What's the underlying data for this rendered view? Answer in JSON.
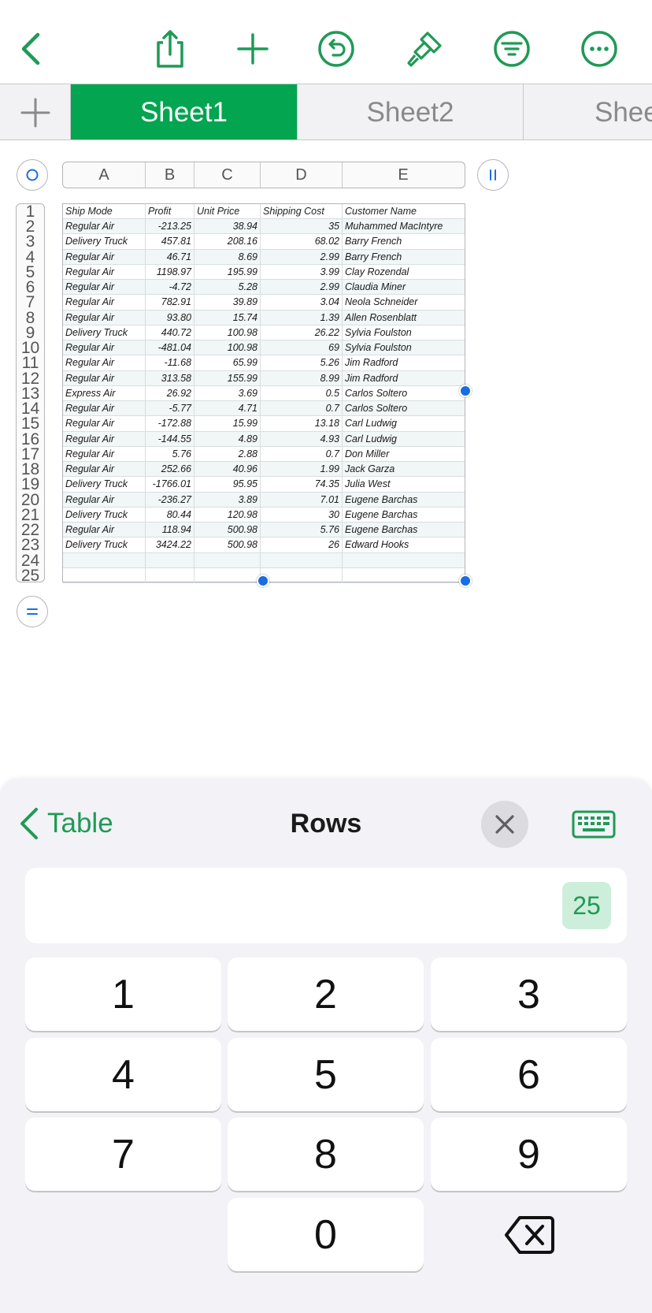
{
  "colors": {
    "accent": "#03a550",
    "icon_green": "#1f9a55",
    "handle_blue": "#1a6de0"
  },
  "toolbar": {
    "icons": [
      "back-chevron-icon",
      "share-icon",
      "add-icon",
      "undo-icon",
      "format-brush-icon",
      "organize-filter-icon",
      "more-icon"
    ]
  },
  "tabs": {
    "add_icon": "plus-icon",
    "items": [
      {
        "label": "Sheet1",
        "active": true
      },
      {
        "label": "Sheet2",
        "active": false
      },
      {
        "label": "Shee",
        "active": false
      }
    ]
  },
  "table": {
    "column_letters": [
      "A",
      "B",
      "C",
      "D",
      "E"
    ],
    "row_numbers": [
      "1",
      "2",
      "3",
      "4",
      "5",
      "6",
      "7",
      "8",
      "9",
      "10",
      "11",
      "12",
      "13",
      "14",
      "15",
      "16",
      "17",
      "18",
      "19",
      "20",
      "21",
      "22",
      "23",
      "24",
      "25"
    ],
    "headers": [
      "Ship Mode",
      "Profit",
      "Unit Price",
      "Shipping Cost",
      "Customer Name"
    ],
    "rows": [
      [
        "Regular Air",
        "-213.25",
        "38.94",
        "35",
        "Muhammed MacIntyre"
      ],
      [
        "Delivery Truck",
        "457.81",
        "208.16",
        "68.02",
        "Barry French"
      ],
      [
        "Regular Air",
        "46.71",
        "8.69",
        "2.99",
        "Barry French"
      ],
      [
        "Regular Air",
        "1198.97",
        "195.99",
        "3.99",
        "Clay Rozendal"
      ],
      [
        "Regular Air",
        "-4.72",
        "5.28",
        "2.99",
        "Claudia Miner"
      ],
      [
        "Regular Air",
        "782.91",
        "39.89",
        "3.04",
        "Neola Schneider"
      ],
      [
        "Regular Air",
        "93.80",
        "15.74",
        "1.39",
        "Allen Rosenblatt"
      ],
      [
        "Delivery Truck",
        "440.72",
        "100.98",
        "26.22",
        "Sylvia Foulston"
      ],
      [
        "Regular Air",
        "-481.04",
        "100.98",
        "69",
        "Sylvia Foulston"
      ],
      [
        "Regular Air",
        "-11.68",
        "65.99",
        "5.26",
        "Jim Radford"
      ],
      [
        "Regular Air",
        "313.58",
        "155.99",
        "8.99",
        "Jim Radford"
      ],
      [
        "Express Air",
        "26.92",
        "3.69",
        "0.5",
        "Carlos Soltero"
      ],
      [
        "Regular Air",
        "-5.77",
        "4.71",
        "0.7",
        "Carlos Soltero"
      ],
      [
        "Regular Air",
        "-172.88",
        "15.99",
        "13.18",
        "Carl Ludwig"
      ],
      [
        "Regular Air",
        "-144.55",
        "4.89",
        "4.93",
        "Carl Ludwig"
      ],
      [
        "Regular Air",
        "5.76",
        "2.88",
        "0.7",
        "Don Miller"
      ],
      [
        "Regular Air",
        "252.66",
        "40.96",
        "1.99",
        "Jack Garza"
      ],
      [
        "Delivery Truck",
        "-1766.01",
        "95.95",
        "74.35",
        "Julia West"
      ],
      [
        "Regular Air",
        "-236.27",
        "3.89",
        "7.01",
        "Eugene Barchas"
      ],
      [
        "Delivery Truck",
        "80.44",
        "120.98",
        "30",
        "Eugene Barchas"
      ],
      [
        "Regular Air",
        "118.94",
        "500.98",
        "5.76",
        "Eugene Barchas"
      ],
      [
        "Delivery Truck",
        "3424.22",
        "500.98",
        "26",
        "Edward Hooks"
      ],
      [
        "",
        "",
        "",
        "",
        ""
      ],
      [
        "",
        "",
        "",
        "",
        ""
      ]
    ]
  },
  "panel": {
    "back_label": "Table",
    "title": "Rows",
    "close_icon": "close-icon",
    "keyboard_icon": "keyboard-icon",
    "value": "25",
    "keys": [
      "1",
      "2",
      "3",
      "4",
      "5",
      "6",
      "7",
      "8",
      "9",
      "0"
    ],
    "delete_icon": "delete-backspace-icon"
  }
}
